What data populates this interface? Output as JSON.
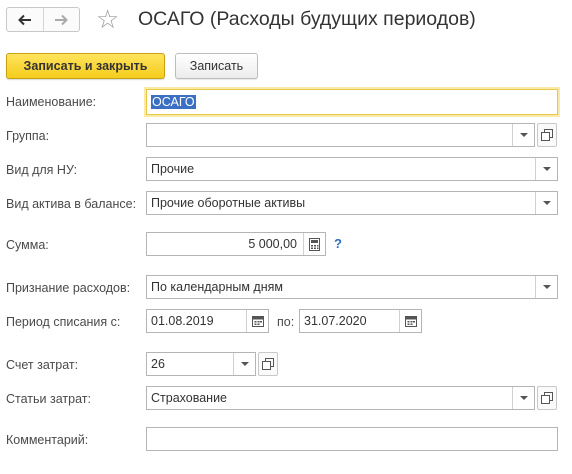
{
  "header": {
    "title": "ОСАГО (Расходы будущих периодов)",
    "back_icon": "arrow-left-icon",
    "forward_icon": "arrow-right-icon",
    "favorite_icon": "star-icon"
  },
  "toolbar": {
    "save_close_label": "Записать и закрыть",
    "save_label": "Записать"
  },
  "form": {
    "name": {
      "label": "Наименование:",
      "value": "ОСАГО"
    },
    "group": {
      "label": "Группа:",
      "value": ""
    },
    "nu_type": {
      "label": "Вид для НУ:",
      "value": "Прочие"
    },
    "asset_type": {
      "label": "Вид актива в балансе:",
      "value": "Прочие оборотные активы"
    },
    "amount": {
      "label": "Сумма:",
      "value": "5 000,00",
      "help": "?"
    },
    "recognition": {
      "label": "Признание расходов:",
      "value": "По календарным дням"
    },
    "period": {
      "label": "Период списания с:",
      "from": "01.08.2019",
      "to_label": "по:",
      "to": "31.07.2020"
    },
    "cost_account": {
      "label": "Счет затрат:",
      "value": "26"
    },
    "cost_items": {
      "label": "Статьи затрат:",
      "value": "Страхование"
    },
    "comment": {
      "label": "Комментарий:",
      "value": ""
    }
  },
  "colors": {
    "primary_button": "#f4cd1c",
    "selection": "#3a6fc4",
    "help": "#2f6fbf"
  }
}
